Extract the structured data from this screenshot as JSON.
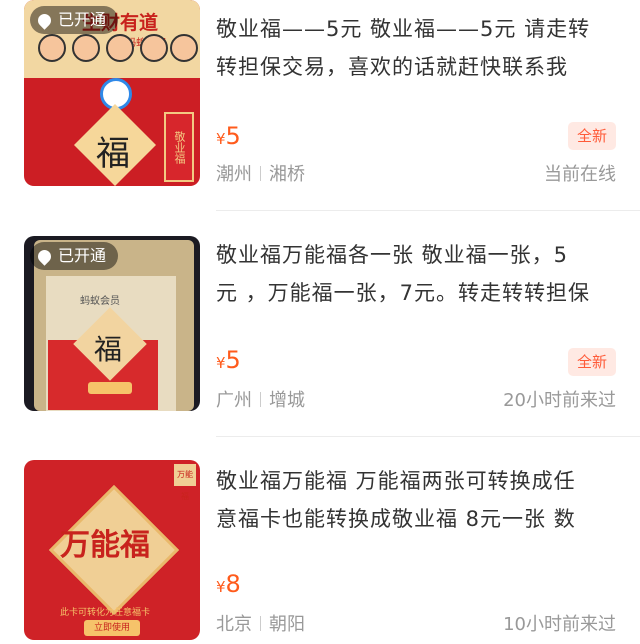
{
  "listings": [
    {
      "badge": "已开通",
      "title_lines": [
        "敬业福——5元 敬业福——5元 请走转",
        "转担保交易，喜欢的话就赶快联系我"
      ],
      "currency": "¥",
      "price": "5",
      "condition": "全新",
      "city": "潮州",
      "district": "湘桥",
      "status": "当前在线",
      "image_text": {
        "banner": "生财有道",
        "banner_sub": "上蚂蚁财富",
        "fu": "福",
        "card": "敬业福"
      }
    },
    {
      "badge": "已开通",
      "title_lines": [
        "敬业福万能福各一张 敬业福一张，5",
        "元 ，万能福一张，7元。转走转转担保"
      ],
      "currency": "¥",
      "price": "5",
      "condition": "全新",
      "city": "广州",
      "district": "增城",
      "status": "20小时前来过",
      "image_text": {
        "vip": "蚂蚁会员",
        "fu": "福"
      }
    },
    {
      "title_lines": [
        "敬业福万能福 万能福两张可转换成任",
        "意福卡也能转换成敬业福 8元一张 数"
      ],
      "currency": "¥",
      "price": "8",
      "city": "北京",
      "district": "朝阳",
      "status": "10小时前来过",
      "image_text": {
        "wanneng": "万能福",
        "footer": "此卡可转化为任意福卡",
        "button": "立即使用",
        "corner": "万能福"
      }
    }
  ],
  "colors": {
    "price": "#ff5b1c",
    "tag_bg": "#ffe9e3",
    "tag_text": "#ff5b39",
    "muted": "#999999",
    "title": "#333333"
  }
}
